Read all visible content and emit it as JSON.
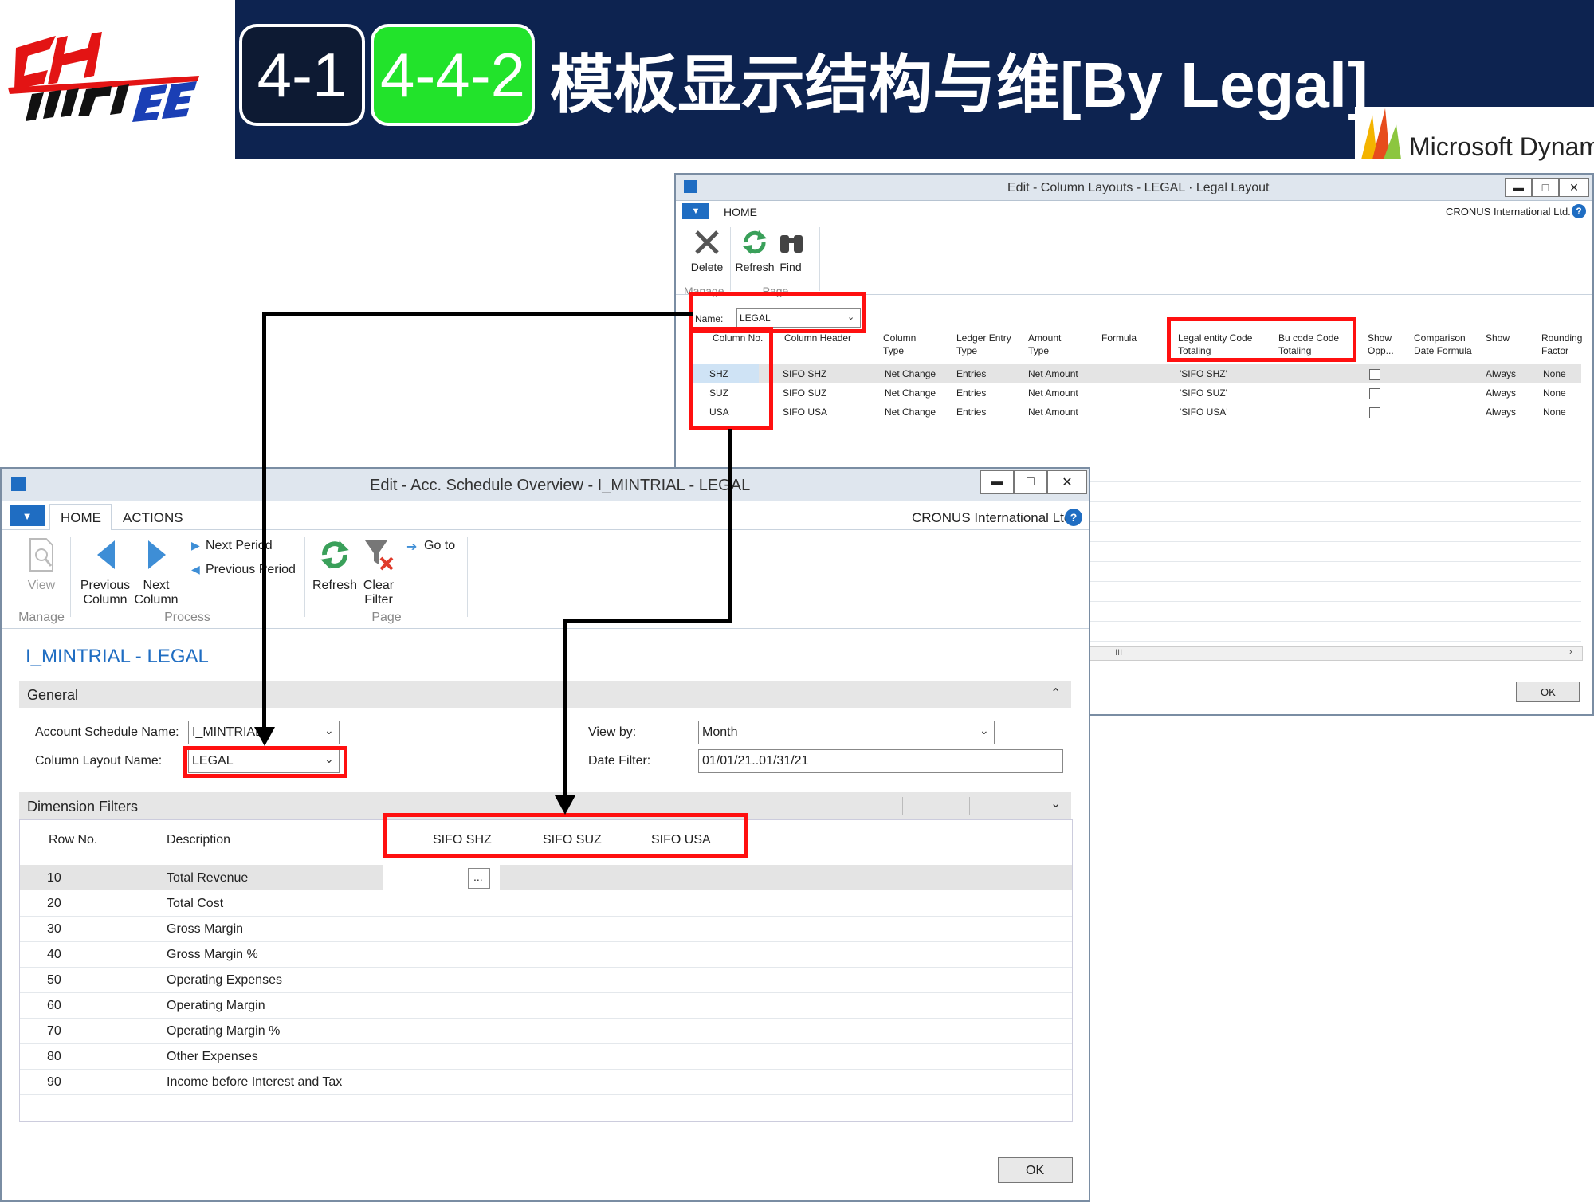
{
  "header": {
    "badge1": "4-1",
    "badge2": "4-4-2",
    "title": "模板显示结构与维[By Legal]",
    "ms_logo": "Microsoft Dynamics",
    "colors": {
      "band": "#0d2350",
      "badge2": "#22e32b",
      "highlight": "#ff1010"
    }
  },
  "win1": {
    "title": "Edit - Column Layouts - LEGAL · Legal Layout",
    "tab_home": "HOME",
    "company": "CRONUS International Ltd.",
    "actions": {
      "delete": "Delete",
      "refresh": "Refresh",
      "find": "Find"
    },
    "groups": {
      "manage": "Manage",
      "page": "Page"
    },
    "name_label": "Name:",
    "name_value": "LEGAL",
    "columns": [
      {
        "line1": "Column No.",
        "line2": ""
      },
      {
        "line1": "Column Header",
        "line2": ""
      },
      {
        "line1": "Column",
        "line2": "Type"
      },
      {
        "line1": "Ledger Entry",
        "line2": "Type"
      },
      {
        "line1": "Amount",
        "line2": "Type"
      },
      {
        "line1": "Formula",
        "line2": ""
      },
      {
        "line1": "Legal entity Code",
        "line2": "Totaling"
      },
      {
        "line1": "Bu code Code",
        "line2": "Totaling"
      },
      {
        "line1": "Show",
        "line2": "Opp..."
      },
      {
        "line1": "Comparison",
        "line2": "Date Formula"
      },
      {
        "line1": "Show",
        "line2": ""
      },
      {
        "line1": "Rounding",
        "line2": "Factor"
      }
    ],
    "rows": [
      {
        "no": "SHZ",
        "header": "SIFO SHZ",
        "ctype": "Net Change",
        "letype": "Entries",
        "atype": "Net Amount",
        "legal": "'SIFO SHZ'",
        "show": "Always",
        "rounding": "None"
      },
      {
        "no": "SUZ",
        "header": "SIFO SUZ",
        "ctype": "Net Change",
        "letype": "Entries",
        "atype": "Net Amount",
        "legal": "'SIFO SUZ'",
        "show": "Always",
        "rounding": "None"
      },
      {
        "no": "USA",
        "header": "SIFO USA",
        "ctype": "Net Change",
        "letype": "Entries",
        "atype": "Net Amount",
        "legal": "'SIFO USA'",
        "show": "Always",
        "rounding": "None"
      }
    ],
    "scroll_mark": "III",
    "ok": "OK"
  },
  "win2": {
    "title": "Edit - Acc. Schedule Overview - I_MINTRIAL - LEGAL",
    "tab_home": "HOME",
    "tab_actions": "ACTIONS",
    "company": "CRONUS International Ltd.",
    "actions": {
      "view": "View",
      "prev_col_1": "Previous",
      "prev_col_2": "Column",
      "next_col_1": "Next",
      "next_col_2": "Column",
      "next_period": "Next Period",
      "prev_period": "Previous Period",
      "refresh": "Refresh",
      "clear_filter_1": "Clear",
      "clear_filter_2": "Filter",
      "goto": "Go to"
    },
    "groups": {
      "manage": "Manage",
      "process": "Process",
      "page": "Page"
    },
    "page_title": "I_MINTRIAL - LEGAL",
    "general": "General",
    "fields": {
      "acc_sched_label": "Account Schedule Name:",
      "acc_sched_value": "I_MINTRIAL",
      "col_layout_label": "Column Layout Name:",
      "col_layout_value": "LEGAL",
      "view_by_label": "View by:",
      "view_by_value": "Month",
      "date_filter_label": "Date Filter:",
      "date_filter_value": "01/01/21..01/31/21"
    },
    "dimension_filters": "Dimension Filters",
    "grid_headers": {
      "row_no": "Row No.",
      "description": "Description",
      "col1": "SIFO SHZ",
      "col2": "SIFO SUZ",
      "col3": "SIFO USA"
    },
    "ellipsis": "...",
    "rows": [
      {
        "no": "10",
        "desc": "Total Revenue"
      },
      {
        "no": "20",
        "desc": "Total Cost"
      },
      {
        "no": "30",
        "desc": "Gross Margin"
      },
      {
        "no": "40",
        "desc": "Gross Margin %"
      },
      {
        "no": "50",
        "desc": "Operating Expenses"
      },
      {
        "no": "60",
        "desc": "Operating Margin"
      },
      {
        "no": "70",
        "desc": "Operating Margin %"
      },
      {
        "no": "80",
        "desc": "Other Expenses"
      },
      {
        "no": "90",
        "desc": "Income before Interest and Tax"
      }
    ],
    "ok": "OK"
  }
}
